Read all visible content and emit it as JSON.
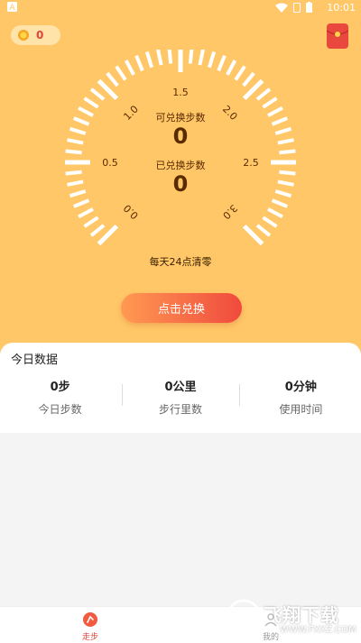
{
  "status_bar": {
    "time": "10:01"
  },
  "header": {
    "coin_value": "0"
  },
  "gauge": {
    "tick_labels": [
      "0.0",
      "0.5",
      "1.0",
      "1.5",
      "2.0",
      "2.5",
      "3.0"
    ],
    "exchangeable_label": "可兑换步数",
    "exchangeable_value": "0",
    "exchanged_label": "已兑换步数",
    "exchanged_value": "0",
    "reset_note": "每天24点清零"
  },
  "exchange_button": {
    "label": "点击兑换"
  },
  "today": {
    "title": "今日数据",
    "stats": [
      {
        "value": "0步",
        "caption": "今日步数"
      },
      {
        "value": "0公里",
        "caption": "步行里数"
      },
      {
        "value": "0分钟",
        "caption": "使用时间"
      }
    ]
  },
  "tabbar": {
    "tabs": [
      {
        "label": "走步",
        "active": true
      },
      {
        "label": "我的",
        "active": false
      }
    ]
  },
  "watermark": {
    "title": "飞翔下载",
    "url": "WWW.FXXZ.COM"
  },
  "colors": {
    "background_top": "#ffc767",
    "accent": "#e0443a",
    "button_start": "#ff9a52",
    "button_end": "#f04a3e"
  }
}
